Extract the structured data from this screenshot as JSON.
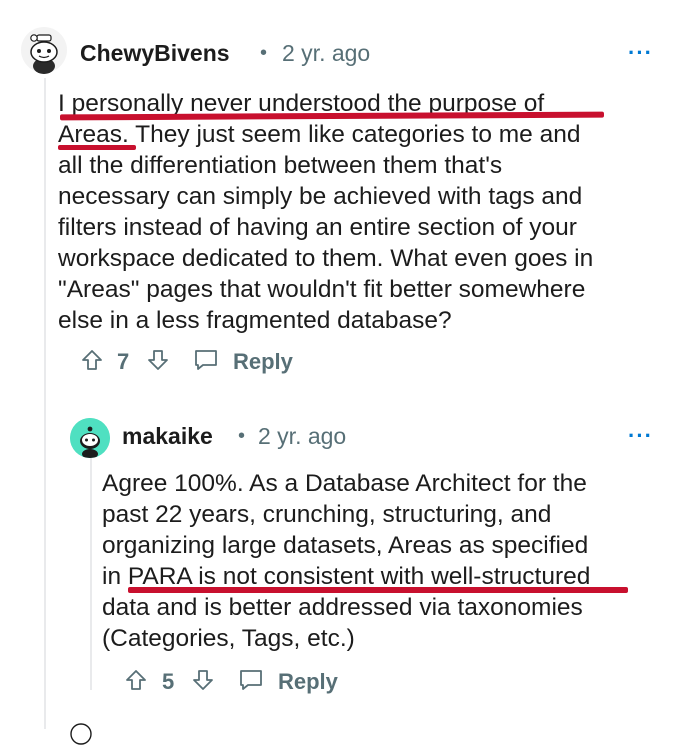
{
  "comments": [
    {
      "username": "ChewyBivens",
      "separator": "•",
      "age": "2 yr. ago",
      "more": "···",
      "body_lines": [
        "I personally never understood the purpose of",
        "Areas. They just seem like categories to me and",
        "all the differentiation between them that's",
        "necessary can simply be achieved with tags and",
        "filters instead of having an entire section of your",
        "workspace dedicated to them. What even goes in",
        "\"Areas\" pages that wouldn't fit better somewhere",
        "else in a less fragmented database?"
      ],
      "upvotes": "7",
      "reply_label": "Reply",
      "icons": [
        "avatar-snoo",
        "upvote-arrow-icon",
        "downvote-arrow-icon",
        "reply-bubble-icon"
      ]
    },
    {
      "username": "makaike",
      "separator": "•",
      "age": "2 yr. ago",
      "more": "···",
      "body_lines": [
        "Agree 100%. As a Database Architect for the",
        "past 22 years, crunching, structuring, and",
        "organizing large datasets, Areas as specified",
        "in PARA is not consistent with well-structured",
        "data and is better addressed via taxonomies",
        "(Categories, Tags, etc.)"
      ],
      "upvotes": "5",
      "reply_label": "Reply",
      "icons": [
        "avatar-snoo-teal",
        "upvote-arrow-icon",
        "downvote-arrow-icon",
        "reply-bubble-icon"
      ]
    }
  ],
  "colors": {
    "annotation_red": "#c8102e",
    "meta_gray": "#576f76",
    "accent_blue": "#0079d3",
    "avatar_teal": "#4fe0c1"
  }
}
